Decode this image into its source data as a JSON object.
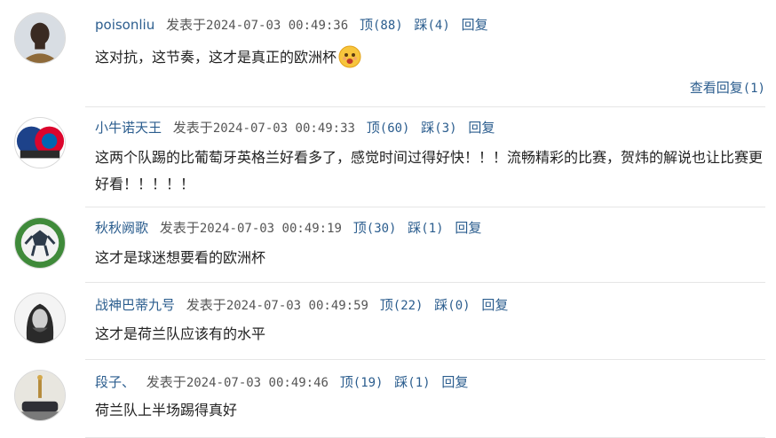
{
  "comments": [
    {
      "user": "poisonliu",
      "posted_prefix": "发表于",
      "time": "2024-07-03 00:49:36",
      "up_label": "顶",
      "up_count": "(88)",
      "down_label": "踩",
      "down_count": "(4)",
      "reply_label": "回复",
      "text": "这对抗，这节奏，这才是真正的欧洲杯",
      "emoji": "face-emoji",
      "view_replies_label": "查看回复",
      "view_replies_count": "(1)"
    },
    {
      "user": "小牛诺天王",
      "posted_prefix": "发表于",
      "time": "2024-07-03 00:49:33",
      "up_label": "顶",
      "up_count": "(60)",
      "down_label": "踩",
      "down_count": "(3)",
      "reply_label": "回复",
      "text": "这两个队踢的比葡萄牙英格兰好看多了，感觉时间过得好快！！！流畅精彩的比赛，贺炜的解说也让比赛更好看！！！！！"
    },
    {
      "user": "秋秋阙歌",
      "posted_prefix": "发表于",
      "time": "2024-07-03 00:49:19",
      "up_label": "顶",
      "up_count": "(30)",
      "down_label": "踩",
      "down_count": "(1)",
      "reply_label": "回复",
      "text": "这才是球迷想要看的欧洲杯"
    },
    {
      "user": "战神巴蒂九号",
      "posted_prefix": "发表于",
      "time": "2024-07-03 00:49:59",
      "up_label": "顶",
      "up_count": "(22)",
      "down_label": "踩",
      "down_count": "(0)",
      "reply_label": "回复",
      "text": "这才是荷兰队应该有的水平"
    },
    {
      "user": "段子、",
      "posted_prefix": "发表于",
      "time": "2024-07-03 00:49:46",
      "up_label": "顶",
      "up_count": "(19)",
      "down_label": "踩",
      "down_count": "(1)",
      "reply_label": "回复",
      "text": "荷兰队上半场踢得真好"
    }
  ],
  "colors": {
    "link": "#2b5d8e",
    "text": "#222222",
    "divider": "#e6e6e6"
  }
}
